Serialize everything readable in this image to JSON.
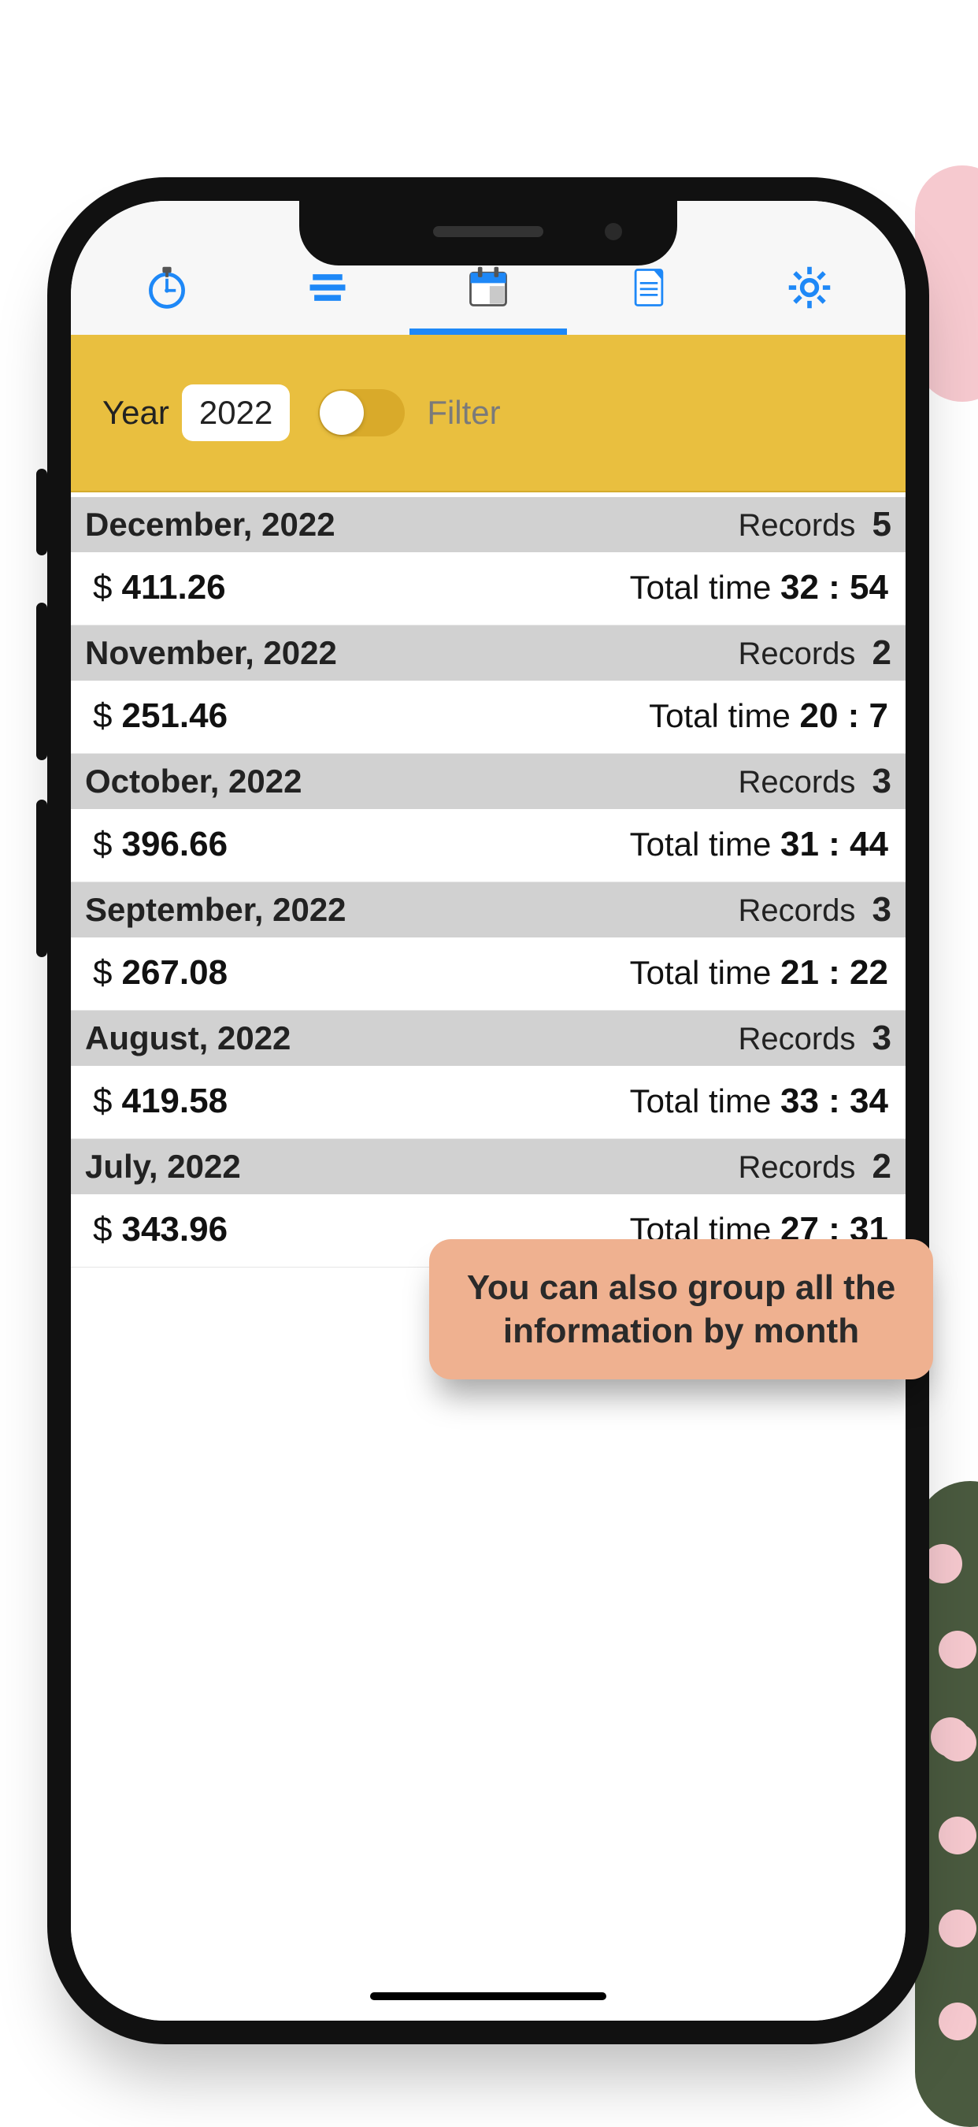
{
  "filter": {
    "year_label": "Year",
    "year_value": "2022",
    "filter_label": "Filter",
    "toggle_on": false
  },
  "labels": {
    "records": "Records",
    "total_time": "Total time",
    "currency": "$"
  },
  "months": [
    {
      "name": "December, 2022",
      "records": "5",
      "amount": "411.26",
      "time": "32 : 54"
    },
    {
      "name": "November, 2022",
      "records": "2",
      "amount": "251.46",
      "time": "20 : 7"
    },
    {
      "name": "October, 2022",
      "records": "3",
      "amount": "396.66",
      "time": "31 : 44"
    },
    {
      "name": "September, 2022",
      "records": "3",
      "amount": "267.08",
      "time": "21 : 22"
    },
    {
      "name": "August, 2022",
      "records": "3",
      "amount": "419.58",
      "time": "33 : 34"
    },
    {
      "name": "July, 2022",
      "records": "2",
      "amount": "343.96",
      "time": "27 : 31"
    }
  ],
  "callout": "You can also group all the information by month"
}
